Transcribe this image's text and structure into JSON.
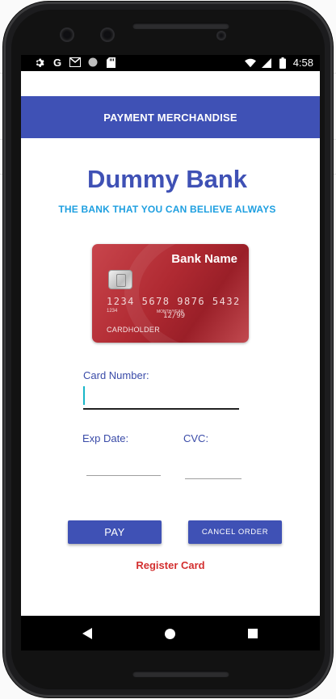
{
  "status_bar": {
    "time": "4:58",
    "left_icons": [
      "settings-icon",
      "google-icon",
      "gmail-icon",
      "circle-icon",
      "sd-card-icon"
    ],
    "right_icons": [
      "wifi-icon",
      "signal-icon",
      "battery-icon"
    ]
  },
  "app_bar": {
    "title": "PAYMENT MERCHANDISE"
  },
  "bank": {
    "name": "Dummy Bank",
    "tagline": "THE BANK THAT YOU CAN BELIEVE ALWAYS"
  },
  "card_image": {
    "bank_name": "Bank Name",
    "number": "1234 5678 9876 5432",
    "small_number": "1234",
    "valid_thru": "MONTH/YEAR",
    "expiry": "12/99",
    "holder": "CARDHOLDER"
  },
  "form": {
    "card_number_label": "Card Number:",
    "card_number_value": "",
    "exp_date_label": "Exp Date:",
    "exp_date_value": "",
    "cvc_label": "CVC:",
    "cvc_value": ""
  },
  "buttons": {
    "pay": "PAY",
    "cancel": "CANCEL ORDER"
  },
  "register_link": "Register Card",
  "colors": {
    "primary": "#3f51b5",
    "tagline": "#1e9fe0",
    "register": "#d32f2f",
    "cursor": "#18b6c8"
  }
}
